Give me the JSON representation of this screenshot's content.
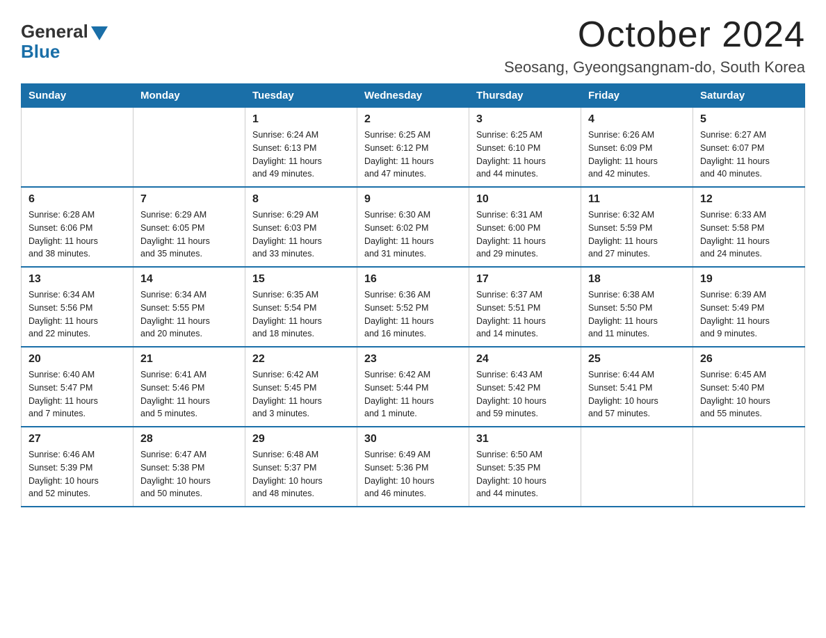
{
  "logo": {
    "general": "General",
    "blue": "Blue"
  },
  "title": "October 2024",
  "subtitle": "Seosang, Gyeongsangnam-do, South Korea",
  "weekdays": [
    "Sunday",
    "Monday",
    "Tuesday",
    "Wednesday",
    "Thursday",
    "Friday",
    "Saturday"
  ],
  "weeks": [
    [
      {
        "day": "",
        "info": ""
      },
      {
        "day": "",
        "info": ""
      },
      {
        "day": "1",
        "info": "Sunrise: 6:24 AM\nSunset: 6:13 PM\nDaylight: 11 hours\nand 49 minutes."
      },
      {
        "day": "2",
        "info": "Sunrise: 6:25 AM\nSunset: 6:12 PM\nDaylight: 11 hours\nand 47 minutes."
      },
      {
        "day": "3",
        "info": "Sunrise: 6:25 AM\nSunset: 6:10 PM\nDaylight: 11 hours\nand 44 minutes."
      },
      {
        "day": "4",
        "info": "Sunrise: 6:26 AM\nSunset: 6:09 PM\nDaylight: 11 hours\nand 42 minutes."
      },
      {
        "day": "5",
        "info": "Sunrise: 6:27 AM\nSunset: 6:07 PM\nDaylight: 11 hours\nand 40 minutes."
      }
    ],
    [
      {
        "day": "6",
        "info": "Sunrise: 6:28 AM\nSunset: 6:06 PM\nDaylight: 11 hours\nand 38 minutes."
      },
      {
        "day": "7",
        "info": "Sunrise: 6:29 AM\nSunset: 6:05 PM\nDaylight: 11 hours\nand 35 minutes."
      },
      {
        "day": "8",
        "info": "Sunrise: 6:29 AM\nSunset: 6:03 PM\nDaylight: 11 hours\nand 33 minutes."
      },
      {
        "day": "9",
        "info": "Sunrise: 6:30 AM\nSunset: 6:02 PM\nDaylight: 11 hours\nand 31 minutes."
      },
      {
        "day": "10",
        "info": "Sunrise: 6:31 AM\nSunset: 6:00 PM\nDaylight: 11 hours\nand 29 minutes."
      },
      {
        "day": "11",
        "info": "Sunrise: 6:32 AM\nSunset: 5:59 PM\nDaylight: 11 hours\nand 27 minutes."
      },
      {
        "day": "12",
        "info": "Sunrise: 6:33 AM\nSunset: 5:58 PM\nDaylight: 11 hours\nand 24 minutes."
      }
    ],
    [
      {
        "day": "13",
        "info": "Sunrise: 6:34 AM\nSunset: 5:56 PM\nDaylight: 11 hours\nand 22 minutes."
      },
      {
        "day": "14",
        "info": "Sunrise: 6:34 AM\nSunset: 5:55 PM\nDaylight: 11 hours\nand 20 minutes."
      },
      {
        "day": "15",
        "info": "Sunrise: 6:35 AM\nSunset: 5:54 PM\nDaylight: 11 hours\nand 18 minutes."
      },
      {
        "day": "16",
        "info": "Sunrise: 6:36 AM\nSunset: 5:52 PM\nDaylight: 11 hours\nand 16 minutes."
      },
      {
        "day": "17",
        "info": "Sunrise: 6:37 AM\nSunset: 5:51 PM\nDaylight: 11 hours\nand 14 minutes."
      },
      {
        "day": "18",
        "info": "Sunrise: 6:38 AM\nSunset: 5:50 PM\nDaylight: 11 hours\nand 11 minutes."
      },
      {
        "day": "19",
        "info": "Sunrise: 6:39 AM\nSunset: 5:49 PM\nDaylight: 11 hours\nand 9 minutes."
      }
    ],
    [
      {
        "day": "20",
        "info": "Sunrise: 6:40 AM\nSunset: 5:47 PM\nDaylight: 11 hours\nand 7 minutes."
      },
      {
        "day": "21",
        "info": "Sunrise: 6:41 AM\nSunset: 5:46 PM\nDaylight: 11 hours\nand 5 minutes."
      },
      {
        "day": "22",
        "info": "Sunrise: 6:42 AM\nSunset: 5:45 PM\nDaylight: 11 hours\nand 3 minutes."
      },
      {
        "day": "23",
        "info": "Sunrise: 6:42 AM\nSunset: 5:44 PM\nDaylight: 11 hours\nand 1 minute."
      },
      {
        "day": "24",
        "info": "Sunrise: 6:43 AM\nSunset: 5:42 PM\nDaylight: 10 hours\nand 59 minutes."
      },
      {
        "day": "25",
        "info": "Sunrise: 6:44 AM\nSunset: 5:41 PM\nDaylight: 10 hours\nand 57 minutes."
      },
      {
        "day": "26",
        "info": "Sunrise: 6:45 AM\nSunset: 5:40 PM\nDaylight: 10 hours\nand 55 minutes."
      }
    ],
    [
      {
        "day": "27",
        "info": "Sunrise: 6:46 AM\nSunset: 5:39 PM\nDaylight: 10 hours\nand 52 minutes."
      },
      {
        "day": "28",
        "info": "Sunrise: 6:47 AM\nSunset: 5:38 PM\nDaylight: 10 hours\nand 50 minutes."
      },
      {
        "day": "29",
        "info": "Sunrise: 6:48 AM\nSunset: 5:37 PM\nDaylight: 10 hours\nand 48 minutes."
      },
      {
        "day": "30",
        "info": "Sunrise: 6:49 AM\nSunset: 5:36 PM\nDaylight: 10 hours\nand 46 minutes."
      },
      {
        "day": "31",
        "info": "Sunrise: 6:50 AM\nSunset: 5:35 PM\nDaylight: 10 hours\nand 44 minutes."
      },
      {
        "day": "",
        "info": ""
      },
      {
        "day": "",
        "info": ""
      }
    ]
  ]
}
